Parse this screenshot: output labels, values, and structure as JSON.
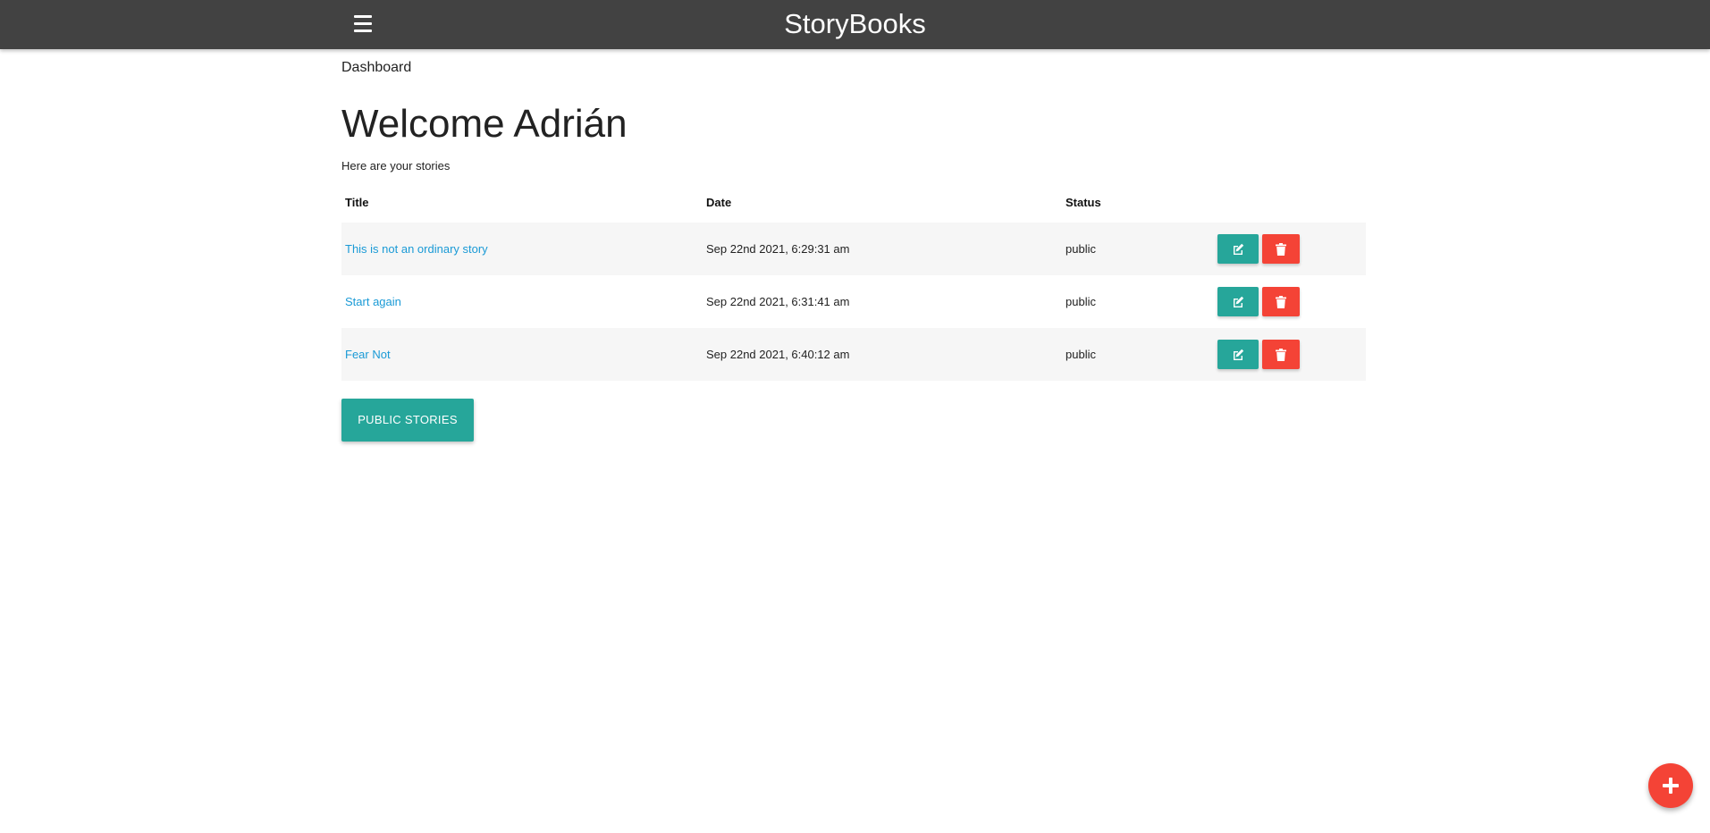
{
  "navbar": {
    "brand": "StoryBooks",
    "menu_icon": "hamburger-menu-icon"
  },
  "page": {
    "label": "Dashboard",
    "welcome": "Welcome Adrián",
    "subtitle": "Here are your stories"
  },
  "table": {
    "headers": [
      "Title",
      "Date",
      "Status",
      ""
    ],
    "rows": [
      {
        "title": "This is not an ordinary story",
        "date": "Sep 22nd 2021, 6:29:31 am",
        "status": "public"
      },
      {
        "title": "Start again",
        "date": "Sep 22nd 2021, 6:31:41 am",
        "status": "public"
      },
      {
        "title": "Fear Not",
        "date": "Sep 22nd 2021, 6:40:12 am",
        "status": "public"
      }
    ],
    "edit_icon": "edit-icon",
    "delete_icon": "trash-icon"
  },
  "public_stories_button": "PUBLIC STORIES",
  "fab_icon": "plus-icon",
  "colors": {
    "navbar": "#424242",
    "teal": "#26a69a",
    "red": "#f44336",
    "link": "#1a9ad6"
  }
}
